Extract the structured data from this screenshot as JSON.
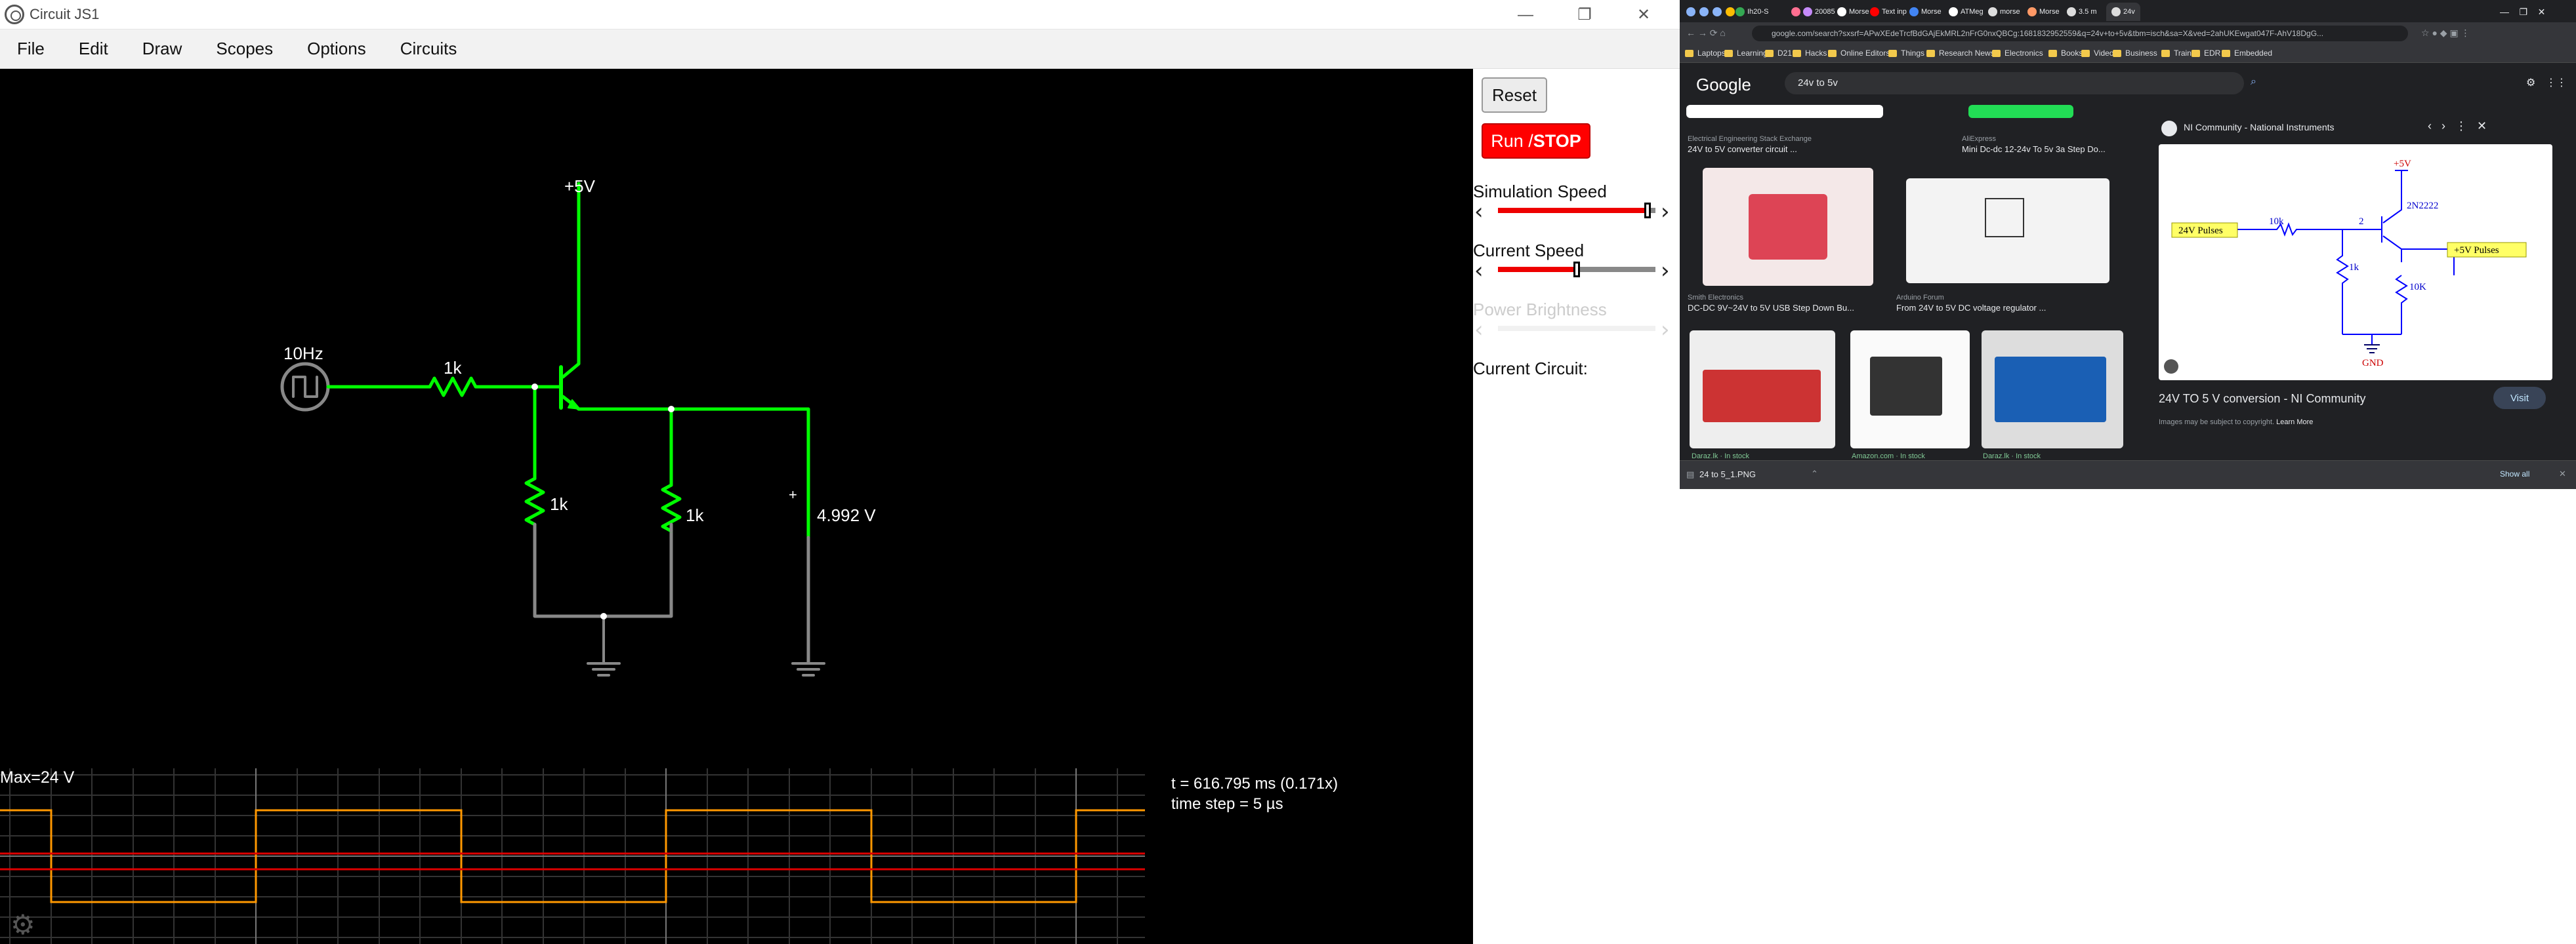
{
  "circuit_app": {
    "title": "Circuit JS1",
    "window_controls": [
      "—",
      "❐",
      "✕"
    ],
    "menu": [
      "File",
      "Edit",
      "Draw",
      "Scopes",
      "Options",
      "Circuits"
    ],
    "labels": {
      "source_freq": "10Hz",
      "r_base": "1k",
      "r_left": "1k",
      "r_right": "1k",
      "vcc": "+5V",
      "voltmeter": "4.992 V",
      "plus": "+"
    },
    "right_panel": {
      "reset": "Reset",
      "run_stop_run": "Run / ",
      "run_stop_stop": "STOP",
      "simulation_speed": "Simulation Speed",
      "current_speed": "Current Speed",
      "power_brightness": "Power Brightness",
      "current_circuit": "Current Circuit:",
      "simulation_speed_level": 0.95,
      "current_speed_level": 0.5
    },
    "scope": {
      "max": "Max=24 V",
      "time": "t = 616.795 ms (0.171x)",
      "timestep": "time step = 5 µs"
    }
  },
  "browser": {
    "address": "google.com/search?sxsrf=APwXEdeTrcfBdGAjEkMRL2nFrG0nxQBCg:1681832952559&q=24v+to+5v&tbm=isch&sa=X&ved=2ahUKEwgat047F-AhV18DgG...",
    "tabs": [
      "Ih20-S",
      "20085",
      "Morse",
      "Text inp",
      "Morse",
      "ATMeg",
      "morse",
      "Morse",
      "3.5 m",
      "24v"
    ],
    "bookmarks": [
      "Laptops",
      "Learning",
      "D21",
      "Hacks",
      "Online Editors",
      "Things",
      "Research News",
      "Electronics",
      "Books",
      "Video",
      "Business",
      "Train",
      "EDR",
      "Embedded"
    ],
    "google_logo": "Google",
    "search_query": "24v to 5v",
    "results": [
      {
        "source": "Electrical Engineering Stack Exchange",
        "title": "24V to 5V converter circuit ..."
      },
      {
        "source": "AliExpress",
        "title": "Mini Dc-dc 12-24v To 5v 3a Step Do..."
      },
      {
        "source": "Smith Electronics",
        "title": "DC-DC 9V~24V to 5V USB Step Down Bu..."
      },
      {
        "source": "Arduino Forum",
        "title": "From 24V to 5V DC voltage regulator ..."
      },
      {
        "source": "Daraz.lk · In stock",
        "title": ""
      },
      {
        "source": "Amazon.com · In stock",
        "title": ""
      },
      {
        "source": "Daraz.lk · In stock",
        "title": ""
      }
    ],
    "panel": {
      "source": "NI Community - National Instruments",
      "title": "24V TO 5 V conversion - NI Community",
      "visit": "Visit",
      "copyright": "Images may be subject to copyright.",
      "learn_more": "Learn More",
      "schematic": {
        "input_label": "24V Pulses",
        "output_label": "+5V Pulses",
        "transistor": "2N2222",
        "r1": "10k",
        "r2": "1k",
        "r3": "10K",
        "vcc": "+5V",
        "gnd": "GND",
        "node": "2"
      }
    },
    "download": {
      "file": "24 to 5_1.PNG",
      "show_all": "Show all"
    }
  }
}
